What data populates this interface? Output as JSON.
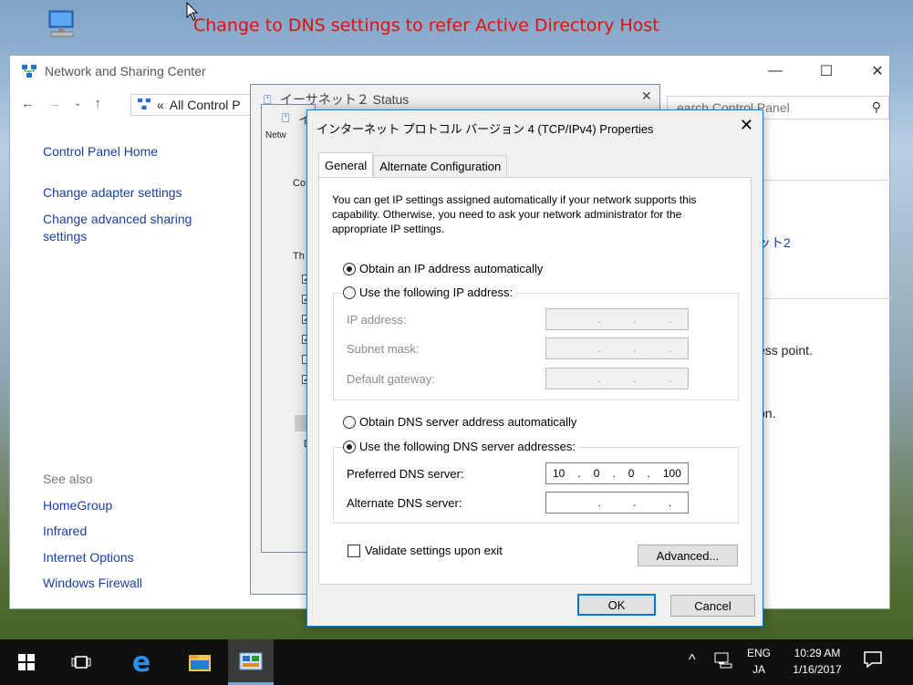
{
  "caption": "Change to DNS settings to refer Active Directory Host",
  "nsc": {
    "title": "Network and Sharing Center",
    "address": "All Control P",
    "search_placeholder": "earch Control Panel",
    "left_nav": [
      "Control Panel Home",
      "Change adapter settings",
      "Change advanced sharing settings"
    ],
    "see_also_header": "See also",
    "see_also": [
      "HomeGroup",
      "Infrared",
      "Internet Options",
      "Windows Firewall"
    ],
    "frag_link": "ット2",
    "frag_access": "ess point.",
    "frag_on": "on."
  },
  "status_dialog": {
    "title": "イーサネット２ Status",
    "frag_title2": "イ",
    "frag_netw": "Netw",
    "frag_co": "Co",
    "frag_th": "Th",
    "frag_d": "D"
  },
  "ipv4": {
    "title": "インターネット プロトコル バージョン 4 (TCP/IPv4) Properties",
    "tabs": [
      "General",
      "Alternate Configuration"
    ],
    "description": "You can get IP settings assigned automatically if your network supports this capability. Otherwise, you need to ask your network administrator for the appropriate IP settings.",
    "obtain_ip": "Obtain an IP address automatically",
    "use_ip": "Use the following IP address:",
    "ip_label": "IP address:",
    "subnet_label": "Subnet mask:",
    "gateway_label": "Default gateway:",
    "obtain_dns": "Obtain DNS server address automatically",
    "use_dns": "Use the following DNS server addresses:",
    "preferred_label": "Preferred DNS server:",
    "alternate_label": "Alternate DNS server:",
    "preferred_dns": [
      "10",
      "0",
      "0",
      "100"
    ],
    "validate": "Validate settings upon exit",
    "advanced": "Advanced...",
    "ok": "OK",
    "cancel": "Cancel"
  },
  "tray": {
    "lang1": "ENG",
    "lang2": "JA",
    "time": "10:29 AM",
    "date": "1/16/2017"
  }
}
